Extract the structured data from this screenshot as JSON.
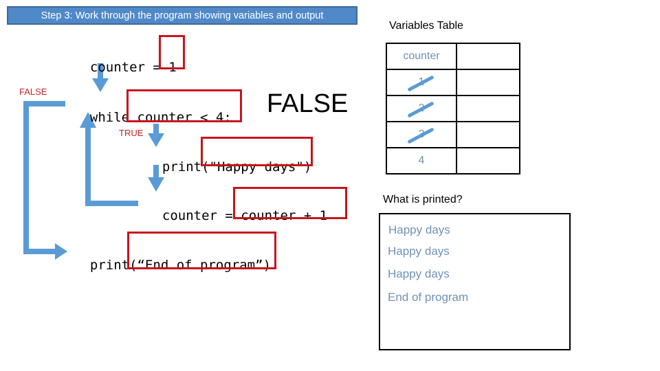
{
  "banner": {
    "text": "Step 3: Work through the program showing variables and output"
  },
  "program": {
    "line_assign": {
      "prefix": "counter = ",
      "highlight": "1"
    },
    "line_while": {
      "prefix": "while ",
      "highlight": "counter < 4:"
    },
    "line_print": {
      "prefix": "print(",
      "highlight": "\"Happy days\"",
      "suffix": ")"
    },
    "line_increment": {
      "prefix": "counter = ",
      "highlight": "counter + 1"
    },
    "line_end": {
      "prefix": "print(",
      "highlight": "“End of program”",
      "suffix": ")"
    }
  },
  "labels": {
    "false_branch": "FALSE",
    "true_branch": "TRUE",
    "condition_result": "FALSE"
  },
  "variables_table": {
    "title": "Variables Table",
    "headers": [
      "counter",
      ""
    ],
    "rows": [
      {
        "value": "1",
        "crossed_out": true
      },
      {
        "value": "2",
        "crossed_out": true
      },
      {
        "value": "3",
        "crossed_out": true
      },
      {
        "value": "4",
        "crossed_out": false
      }
    ]
  },
  "output": {
    "title": "What is printed?",
    "lines": [
      "Happy days",
      "Happy days",
      "Happy days",
      "End of program"
    ]
  },
  "colors": {
    "arrow": "#5b9bd5",
    "highlight_box": "#c8141c",
    "banner": "#5089c9",
    "handwriting": "#6e93b5"
  }
}
